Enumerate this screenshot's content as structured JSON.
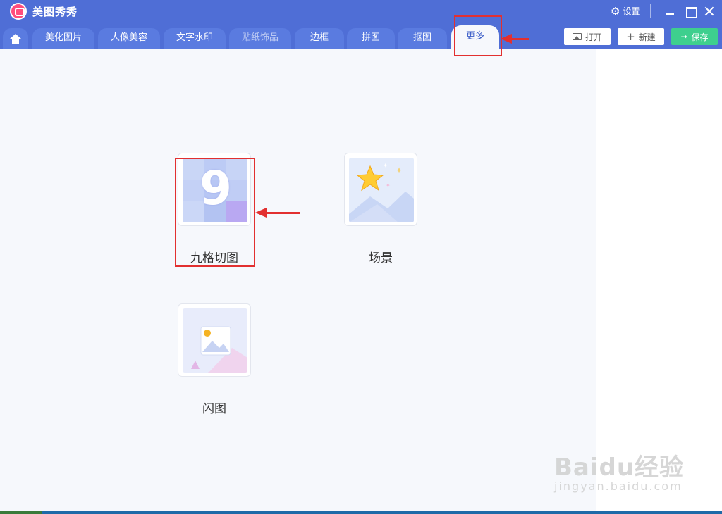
{
  "app": {
    "title": "美图秀秀",
    "settings_label": "设置"
  },
  "tabs": [
    {
      "label": "美化图片",
      "state": "normal"
    },
    {
      "label": "人像美容",
      "state": "normal"
    },
    {
      "label": "文字水印",
      "state": "normal"
    },
    {
      "label": "贴纸饰品",
      "state": "disabled"
    },
    {
      "label": "边框",
      "state": "normal"
    },
    {
      "label": "拼图",
      "state": "normal"
    },
    {
      "label": "抠图",
      "state": "normal"
    },
    {
      "label": "更多",
      "state": "active"
    }
  ],
  "actions": {
    "open": "打开",
    "new": "新建",
    "save": "保存"
  },
  "tools": [
    {
      "label": "九格切图",
      "icon": "nine-grid-icon"
    },
    {
      "label": "场景",
      "icon": "scene-star-icon"
    },
    {
      "label": "闪图",
      "icon": "flash-image-icon"
    }
  ],
  "watermark": {
    "main": "Baidu经验",
    "sub": "jingyan.baidu.com"
  },
  "colors": {
    "title_bar": "#4f6ed6",
    "tab": "#5a7be0",
    "active_tab_text": "#3c5ec8",
    "save_button": "#3ecf8e",
    "annotation": "#e23030",
    "canvas": "#f6f8fc"
  }
}
